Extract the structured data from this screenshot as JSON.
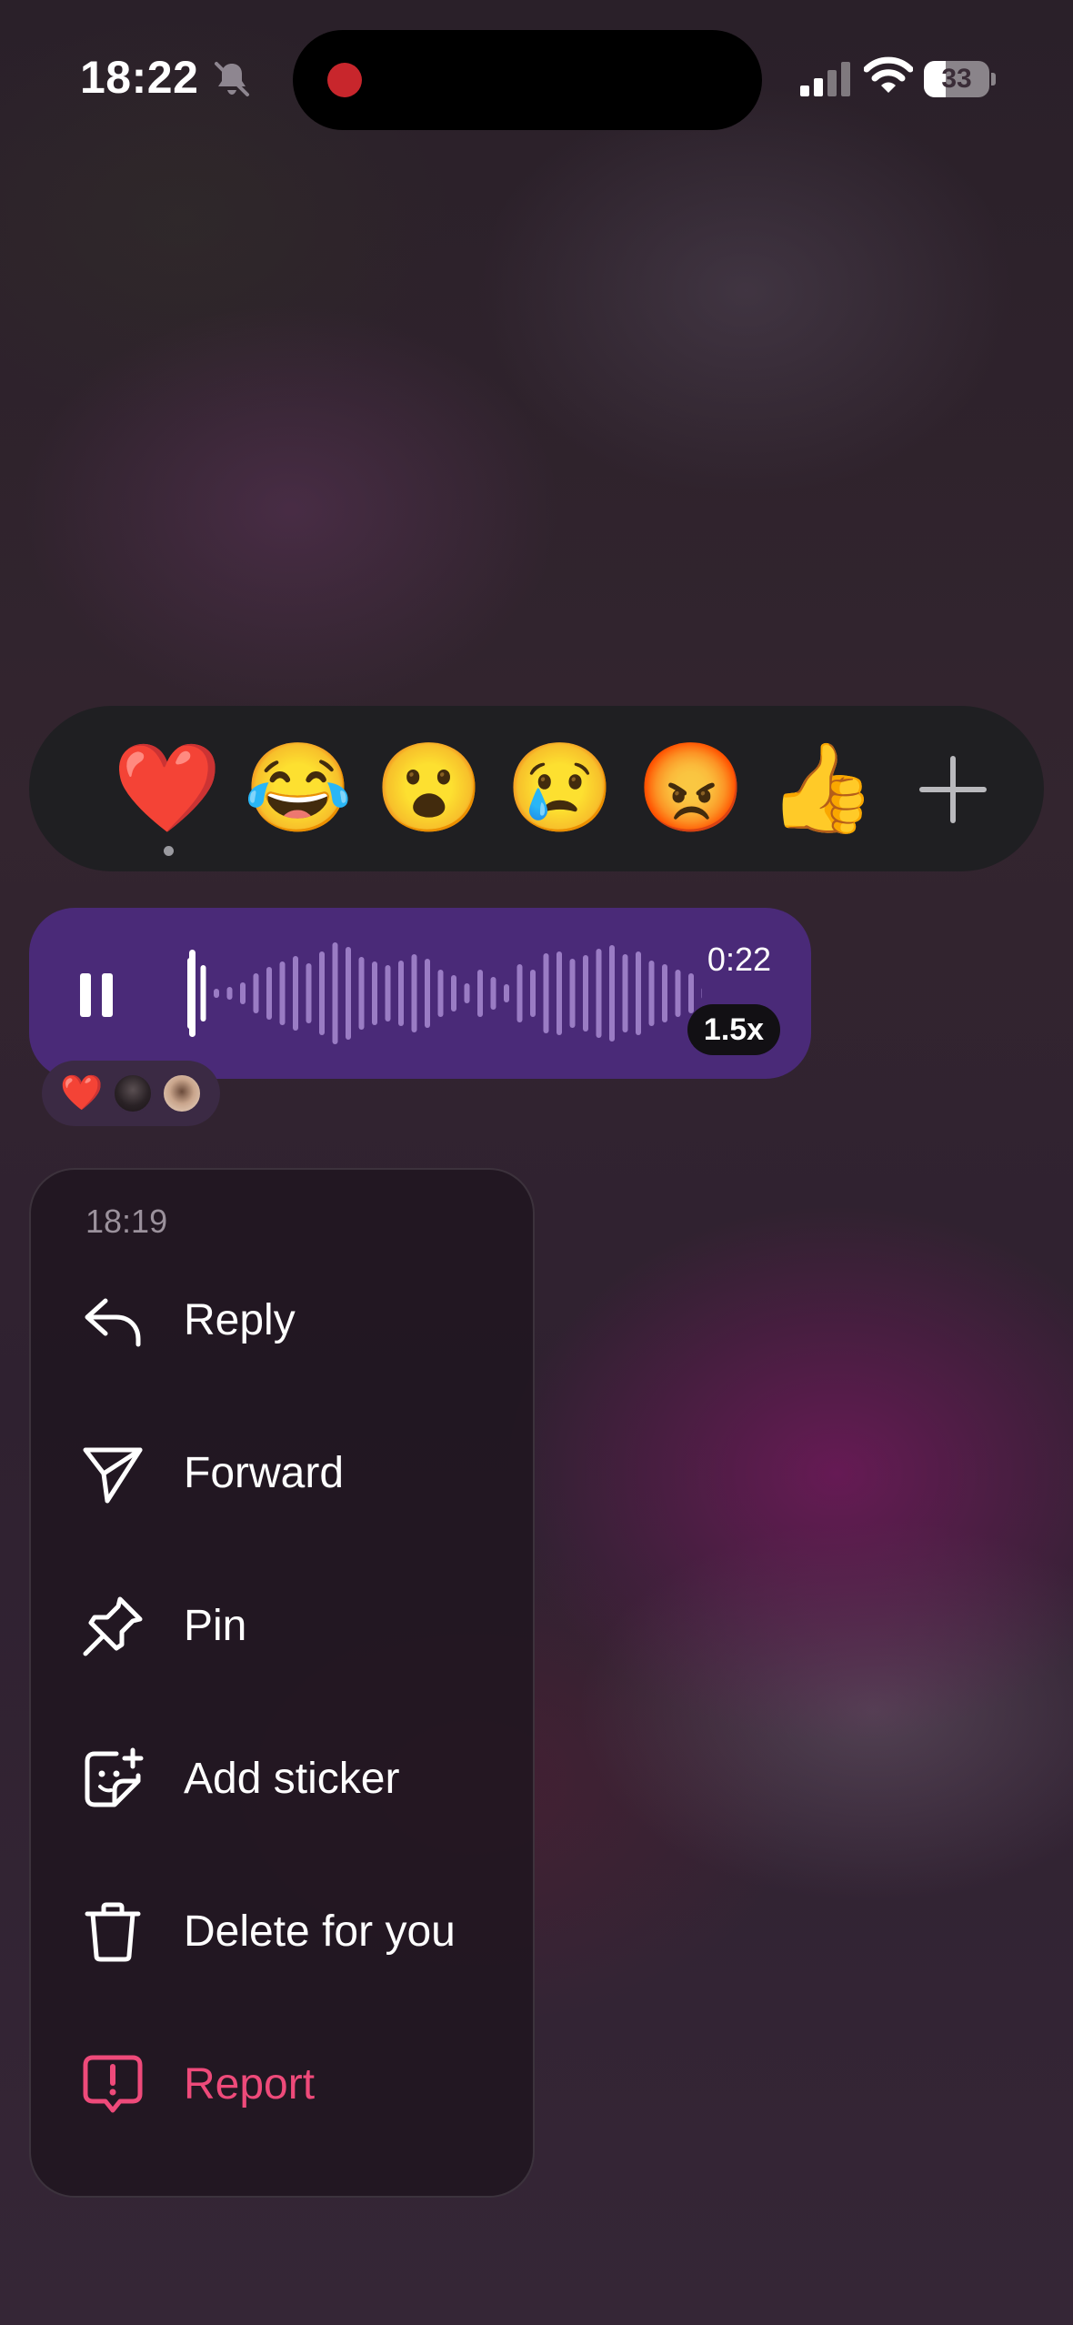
{
  "status_bar": {
    "time": "18:22",
    "battery_percent": "33",
    "battery_level": 0.33,
    "icons": [
      "bell-slash-icon",
      "signal-icon",
      "wifi-icon",
      "battery-icon"
    ]
  },
  "reaction_bar": {
    "reactions": [
      {
        "emoji": "❤️",
        "name": "heart"
      },
      {
        "emoji": "😂",
        "name": "laughing"
      },
      {
        "emoji": "😮",
        "name": "surprised"
      },
      {
        "emoji": "😢",
        "name": "crying"
      },
      {
        "emoji": "😡",
        "name": "angry"
      },
      {
        "emoji": "👍",
        "name": "thumbs-up"
      }
    ],
    "add_icon": "plus-icon"
  },
  "voice_message": {
    "duration": "0:22",
    "speed": "1.5x",
    "state_icon": "pause-icon"
  },
  "reactions_summary": {
    "emoji": "❤️"
  },
  "context_menu": {
    "time": "18:19",
    "items": [
      {
        "label": "Reply",
        "icon": "reply-icon"
      },
      {
        "label": "Forward",
        "icon": "forward-icon"
      },
      {
        "label": "Pin",
        "icon": "pin-icon"
      },
      {
        "label": "Add sticker",
        "icon": "add-sticker-icon"
      },
      {
        "label": "Delete for you",
        "icon": "trash-icon"
      },
      {
        "label": "Report",
        "icon": "report-icon"
      }
    ]
  },
  "colors": {
    "bubble": "#4a2a78",
    "reaction_bar": "#1f1f22",
    "menu": "#201620",
    "danger": "#ee4a7a",
    "record_dot": "#c8262c"
  }
}
